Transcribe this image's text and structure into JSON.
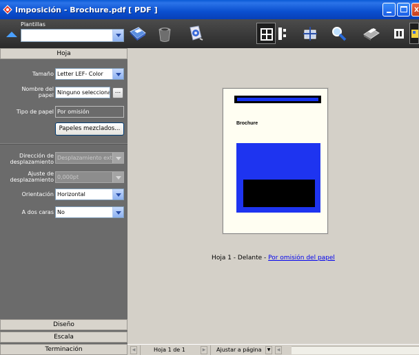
{
  "window": {
    "title": "Imposición - Brochure.pdf [ PDF ]",
    "accent": "#0a4fcf"
  },
  "toolbar": {
    "templates_label": "Plantillas",
    "templates_value": "",
    "icons": [
      "save-icon",
      "trash-icon",
      "document-gear-icon",
      "layout-grid-icon",
      "layout-columns-icon",
      "move-icon",
      "zoom-icon",
      "printer-icon",
      "panel-icon",
      "color-panel-icon"
    ]
  },
  "sidebar": {
    "sections": {
      "hoja": "Hoja",
      "diseno": "Diseño",
      "escala": "Escala",
      "terminacion": "Terminación"
    },
    "fields": {
      "size_label": "Tamaño",
      "size_value": "Letter LEF- Color",
      "paper_name_label": "Nombre del papel",
      "paper_name_value": "Ninguno seleccionado",
      "paper_name_button": "...",
      "paper_type_label": "Tipo de papel",
      "paper_type_value": "Por omisión",
      "mixed_papers_button": "Papeles mezclados...",
      "shift_direction_label": "Dirección de desplazamiento",
      "shift_direction_value": "Desplazamiento exterior",
      "shift_adjust_label": "Ajuste de desplazamiento",
      "shift_adjust_value": "0,000pt",
      "orientation_label": "Orientación",
      "orientation_value": "Horizontal",
      "duplex_label": "A dos caras",
      "duplex_value": "No"
    }
  },
  "preview": {
    "page_text": "Brochure",
    "caption_prefix": "Hoja 1 - Delante - ",
    "caption_link": "Por omisión del papel",
    "colors": {
      "blue": "#1e34f0",
      "paper": "#fffef2"
    }
  },
  "statusbar": {
    "sheet": "Hoja 1 de 1",
    "zoom": "Ajustar a página"
  }
}
